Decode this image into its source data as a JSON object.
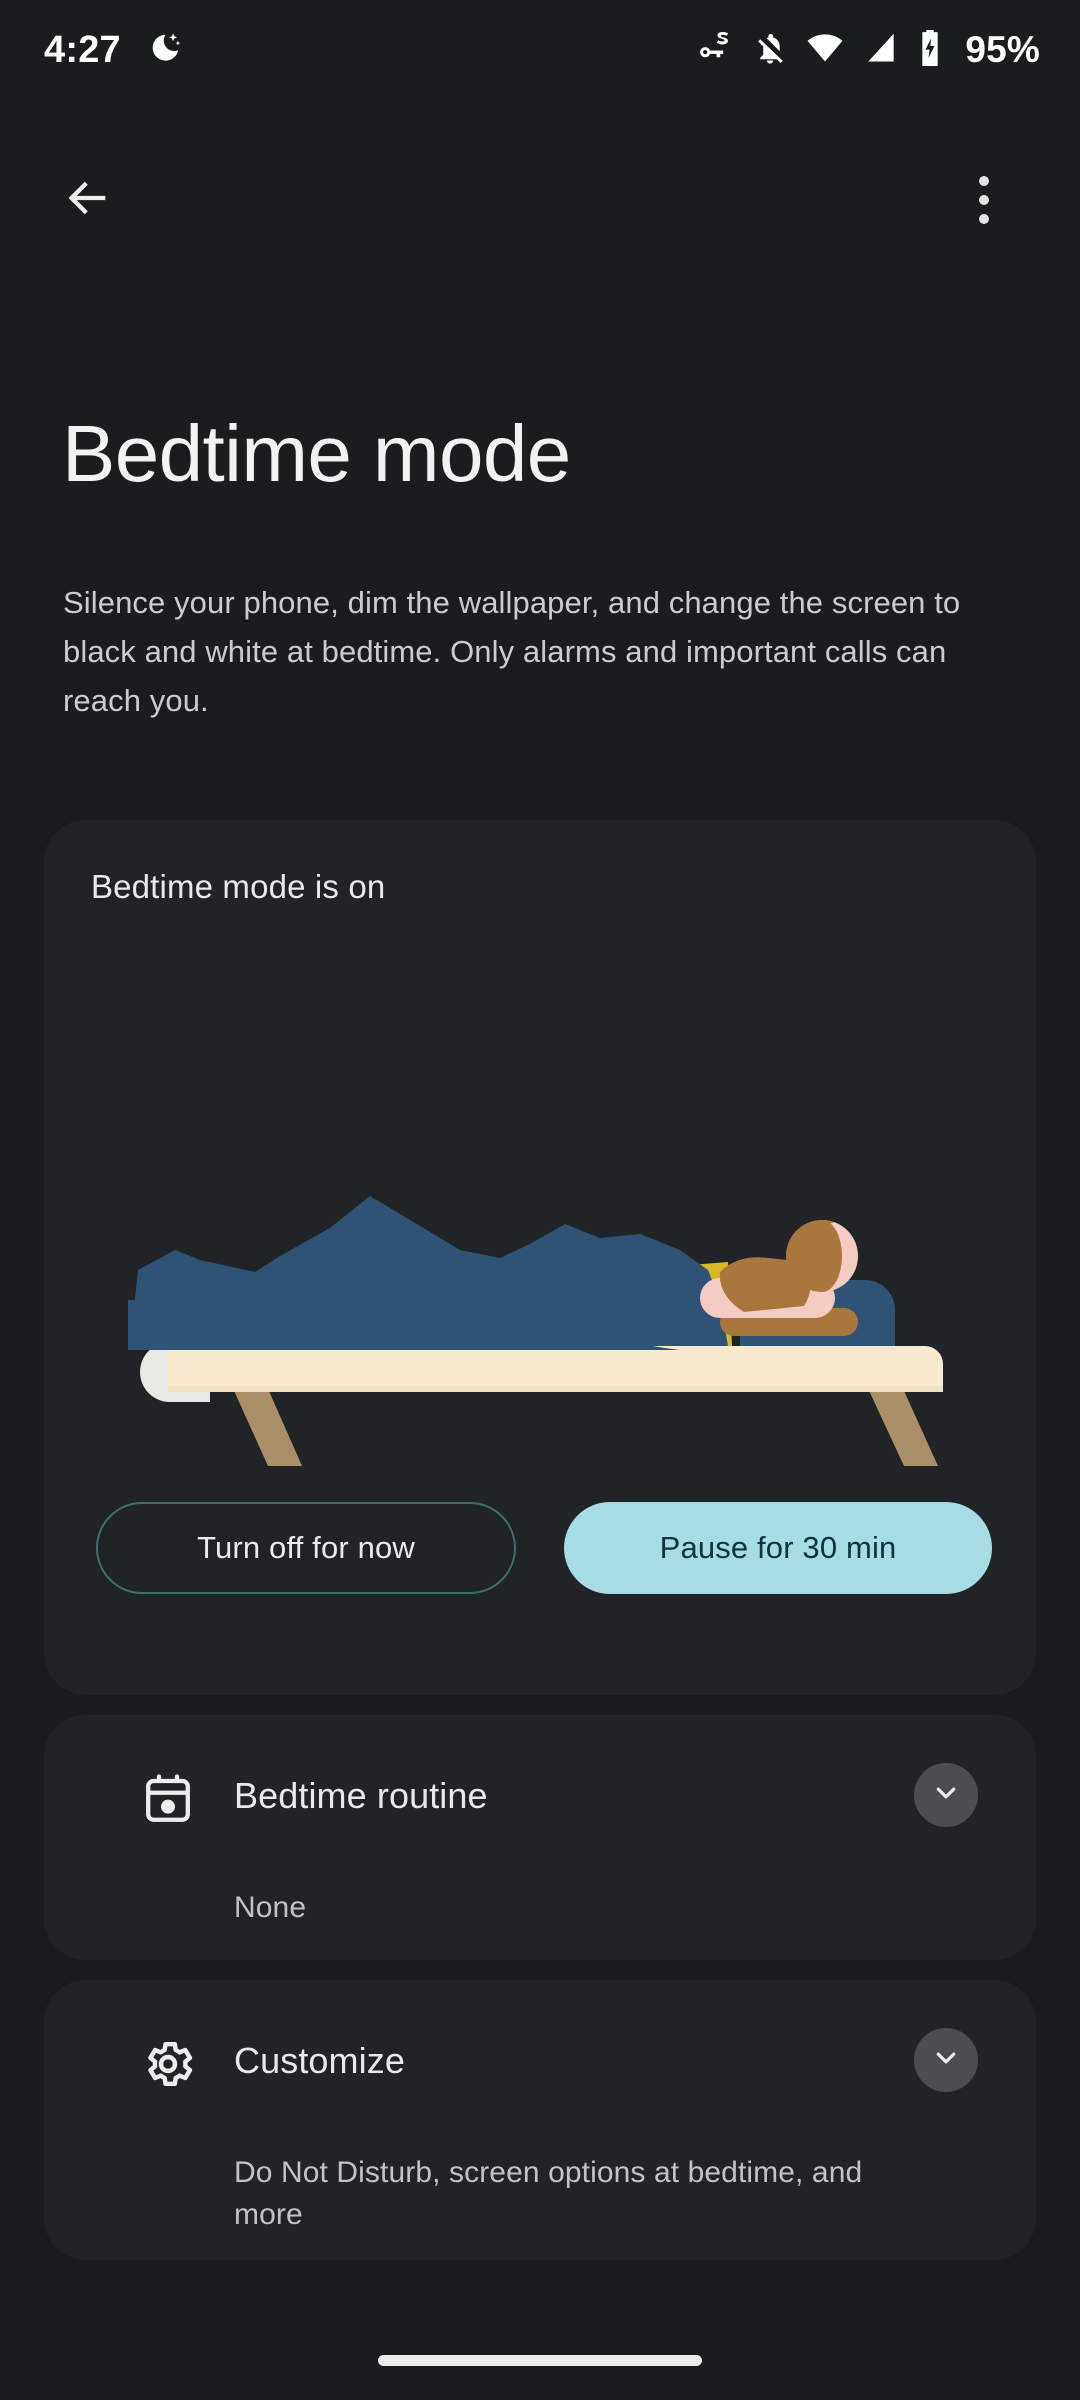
{
  "status_bar": {
    "time": "4:27",
    "battery_percent": "95%",
    "icons": {
      "bedtime": "moon-stars-icon",
      "vpn_key": "vpn-key-g-icon",
      "notifications_off": "bell-off-icon",
      "wifi": "wifi-icon",
      "cellular": "cellular-signal-icon",
      "battery": "battery-charging-icon"
    }
  },
  "app_bar": {
    "back": "back-arrow-icon",
    "overflow": "more-options-icon"
  },
  "page": {
    "title": "Bedtime mode",
    "description": "Silence your phone, dim the wallpaper, and change the screen to black and white at bedtime. Only alarms and important calls can reach you."
  },
  "status_card": {
    "heading": "Bedtime mode is on",
    "illustration": "person-sleeping-in-bed-illustration",
    "buttons": {
      "turn_off": "Turn off for now",
      "pause": "Pause for 30 min"
    }
  },
  "rows": [
    {
      "icon": "calendar-event-icon",
      "title": "Bedtime routine",
      "subtitle": "None",
      "expand": "chevron-down-icon"
    },
    {
      "icon": "gear-icon",
      "title": "Customize",
      "subtitle": "Do Not Disturb, screen options at bedtime, and more",
      "expand": "chevron-down-icon"
    }
  ],
  "nav": {
    "home_pill": "gesture-nav-pill"
  },
  "colors": {
    "background": "#1a1d1e",
    "card": "#212426",
    "accent_filled": "#a8dce4",
    "accent_outline": "#3e6f6f",
    "text_primary": "#e7eaea",
    "text_secondary": "#c0c4c4",
    "blanket_blue": "#2f5375",
    "mattress_cream": "#f7e9ce",
    "bed_leg_tan": "#ab8f68",
    "hair_brown": "#a9773e",
    "skin_pink": "#f5ccc4",
    "shirt_yellow": "#d8b828",
    "pillow_white": "#e8e9e3"
  }
}
